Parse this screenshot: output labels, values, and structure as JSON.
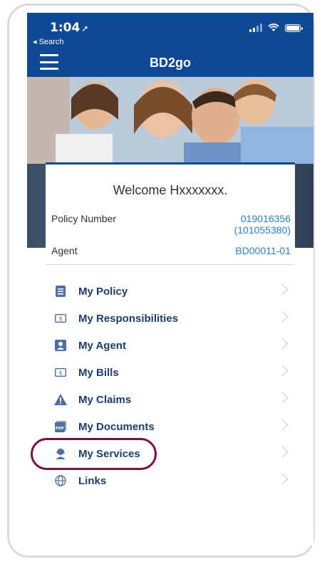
{
  "status": {
    "time": "1:04",
    "back_label": "◂ Search"
  },
  "app": {
    "title": "BD2go"
  },
  "hero": {
    "description": "family photo"
  },
  "account": {
    "welcome": "Welcome Hxxxxxxx.",
    "policy_label": "Policy Number",
    "policy_number_line1": "019016356",
    "policy_number_line2": "(101055380)",
    "agent_label": "Agent",
    "agent_code": "BD00011-01"
  },
  "menu": [
    {
      "label": "My Policy",
      "icon": "document-icon"
    },
    {
      "label": "My Responsibilities",
      "icon": "dollar-bill-icon"
    },
    {
      "label": "My Agent",
      "icon": "person-card-icon"
    },
    {
      "label": "My Bills",
      "icon": "dollar-bill-icon"
    },
    {
      "label": "My Claims",
      "icon": "warning-icon"
    },
    {
      "label": "My Documents",
      "icon": "pdf-icon"
    },
    {
      "label": "My Services",
      "icon": "support-agent-icon"
    },
    {
      "label": "Links",
      "icon": "globe-icon"
    }
  ],
  "colors": {
    "brand": "#0d4a93",
    "link": "#2a84c9",
    "menu_text": "#1f3d6b",
    "highlight": "#7a1147"
  }
}
